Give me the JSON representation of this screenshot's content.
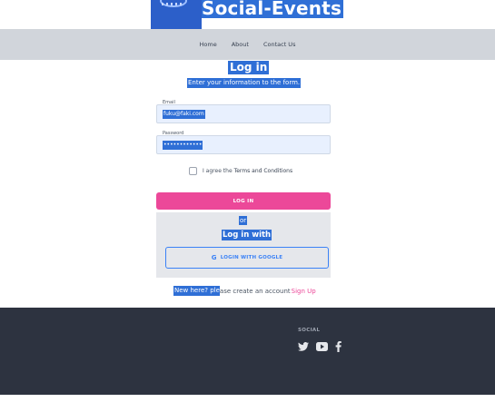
{
  "brand": {
    "title": "Social-Events"
  },
  "nav": {
    "items": [
      "Home",
      "About",
      "Contact Us"
    ]
  },
  "login": {
    "title": "Log in",
    "subtitle": "Enter your information to the form.",
    "email_label": "Email",
    "email_value": "fuku@faki.com",
    "password_label": "Password",
    "password_value": "••••••••••••",
    "agree_prefix": "I agree the",
    "agree_terms": "Terms and Conditions",
    "login_button": "LOG IN",
    "or_text": "or",
    "login_with": "Log in with",
    "google_button": "LOGIN WITH GOOGLE",
    "new_here_selected": "New here? ple",
    "new_here_rest": "ase create an account",
    "signup_link": "Sign Up"
  },
  "footer": {
    "social_heading": "SOCIAL",
    "icons": [
      "twitter-icon",
      "youtube-icon",
      "facebook-icon"
    ]
  },
  "colors": {
    "accent_pink": "#ec4899",
    "selection_blue": "#2f6fd6",
    "google_blue": "#3b82f6",
    "footer_bg": "#2d3340",
    "nav_bg": "#d1d5db"
  }
}
